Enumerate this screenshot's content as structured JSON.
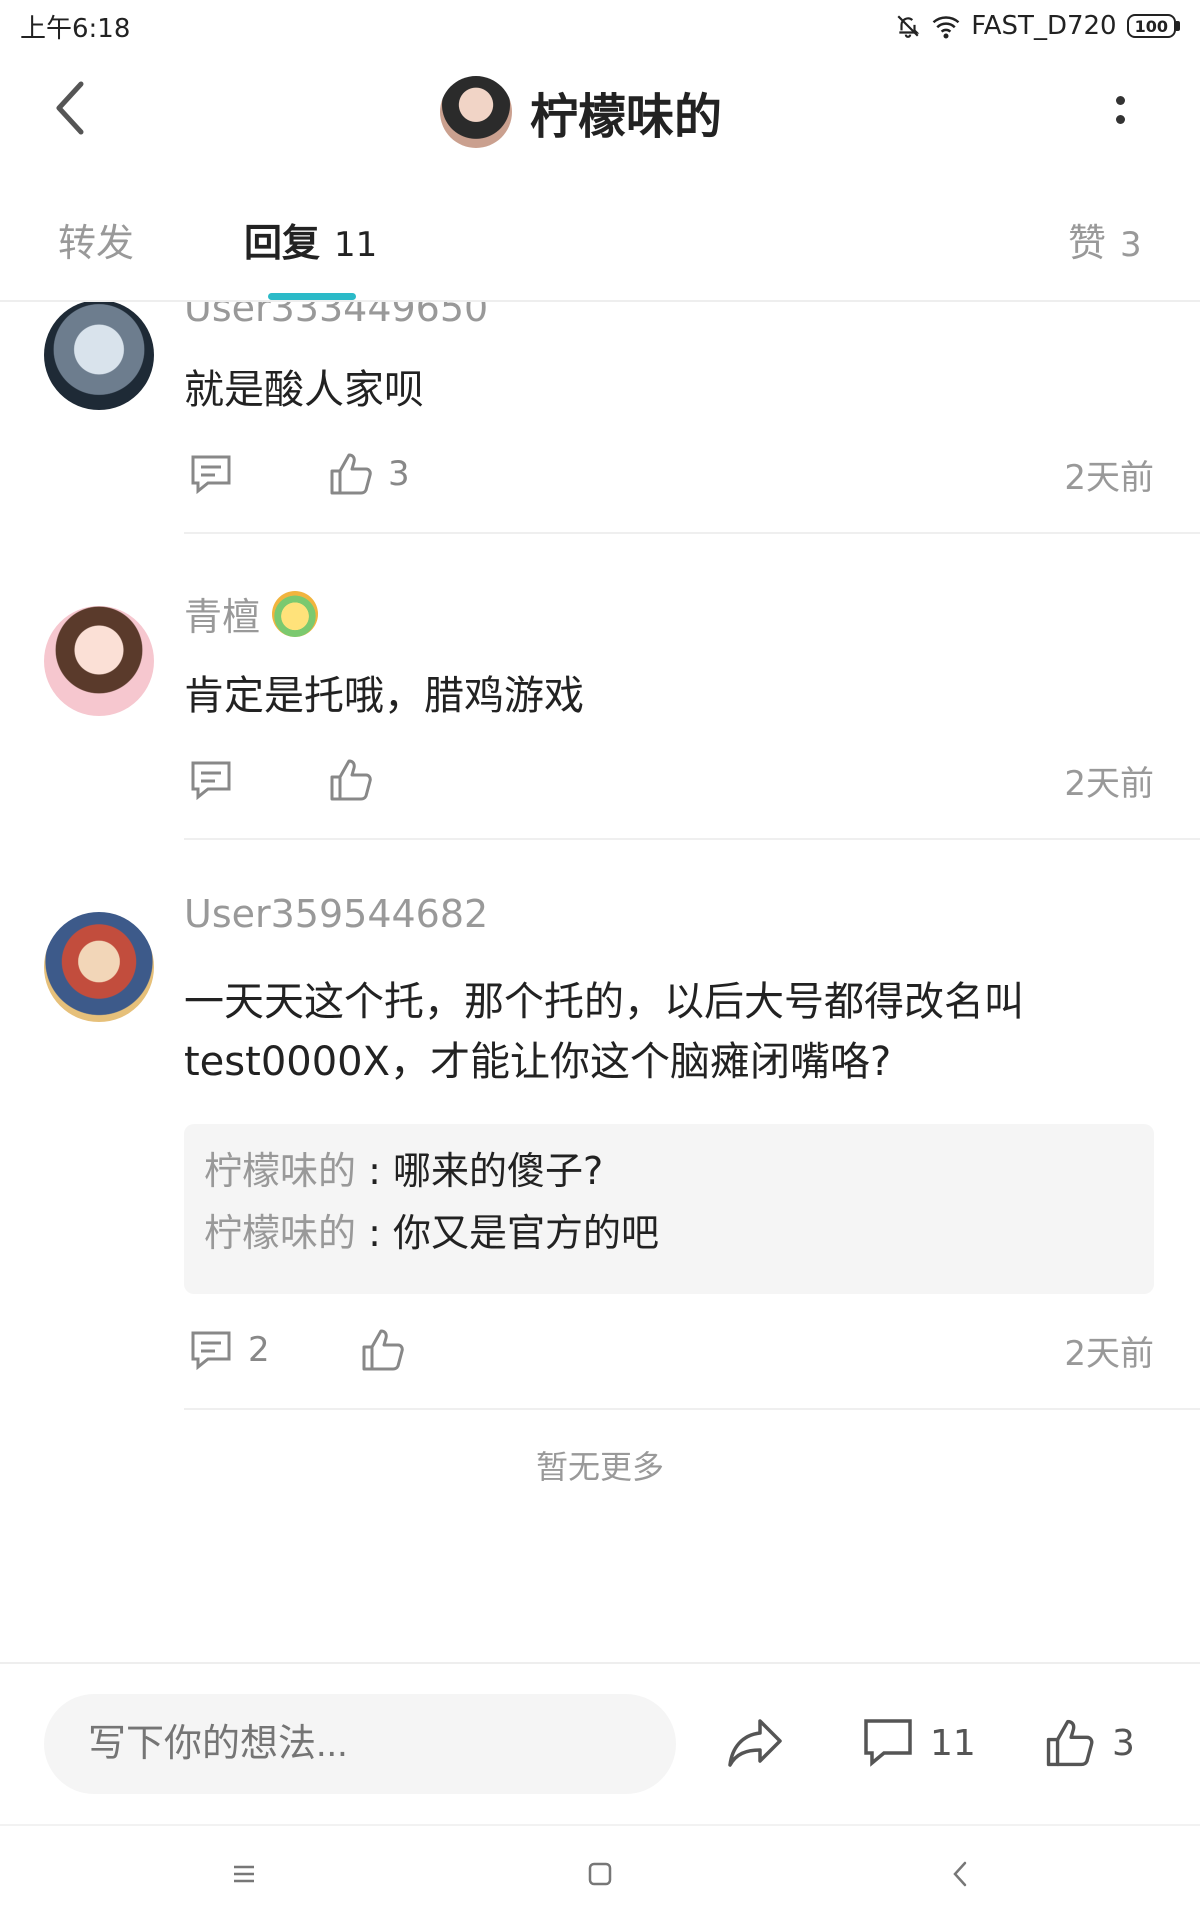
{
  "status_bar": {
    "time": "上午6:18",
    "network": "FAST_D720",
    "battery": "100"
  },
  "header": {
    "title": "柠檬味的"
  },
  "tabs": [
    {
      "label": "转发",
      "count": ""
    },
    {
      "label": "回复",
      "count": "11"
    },
    {
      "label": "赞",
      "count": "3"
    }
  ],
  "comments": [
    {
      "username": "User333449650",
      "text": "就是酸人家呗",
      "like_count": "3",
      "reply_count": "",
      "time": "2天前"
    },
    {
      "username": "青檀",
      "text": "肯定是托哦，腊鸡游戏",
      "like_count": "",
      "reply_count": "",
      "time": "2天前"
    },
    {
      "username": "User359544682",
      "text_line1": "一天天这个托，那个托的，以后大号都得改名叫",
      "text_line2": "test0000X，才能让你这个脑瘫闭嘴咯?",
      "sub_replies": [
        {
          "author": "柠檬味的",
          "sep": " : ",
          "text": "哪来的傻子?"
        },
        {
          "author": "柠檬味的",
          "sep": " : ",
          "text": "你又是官方的吧"
        }
      ],
      "reply_count": "2",
      "like_count": "",
      "time": "2天前"
    }
  ],
  "no_more_text": "暂无更多",
  "bottom_bar": {
    "input_placeholder": "写下你的想法...",
    "comment_count": "11",
    "like_count": "3"
  },
  "icons": {
    "back": "back-arrow-icon",
    "more": "more-vertical-icon",
    "comment": "comment-icon",
    "like": "thumbs-up-icon",
    "share": "share-icon"
  },
  "colors": {
    "accent": "#2bbac8",
    "muted_text": "#999999",
    "sub_reply_bg": "#f5f5f5"
  }
}
